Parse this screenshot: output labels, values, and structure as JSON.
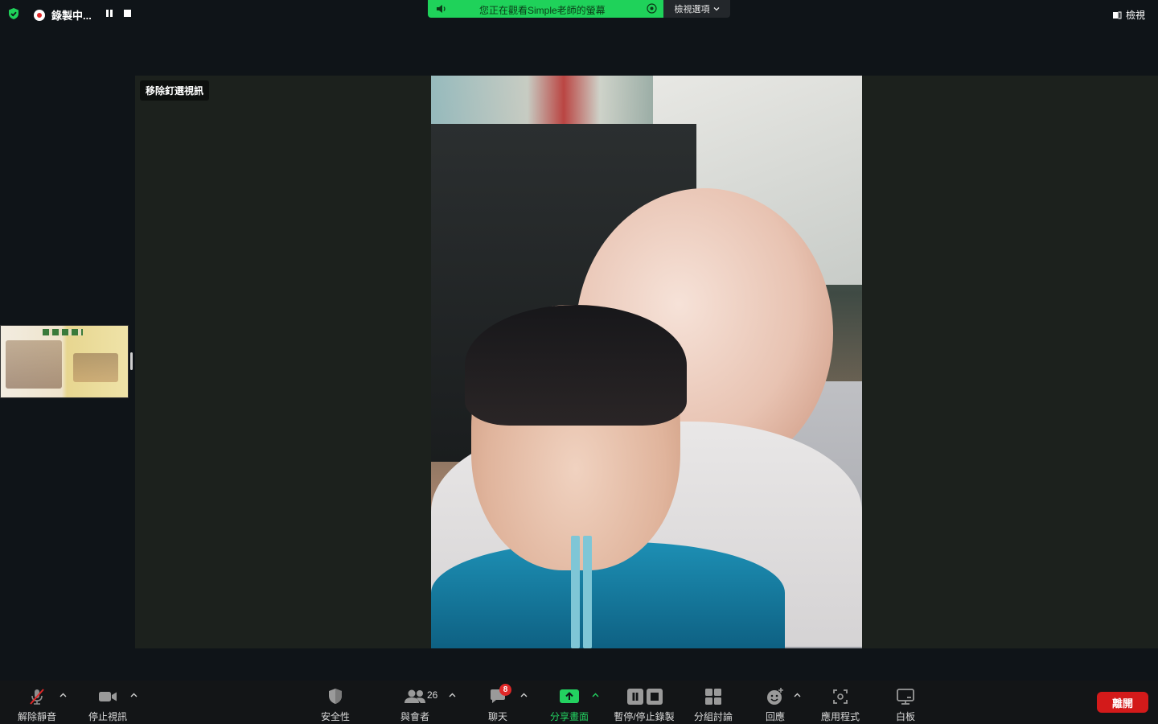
{
  "topbar": {
    "recording_label": "錄製中...",
    "banner_text": "您正在觀看Simple老師的螢幕",
    "view_options": "檢視選項",
    "view_button": "檢視"
  },
  "stage": {
    "unpin_label": "移除釘選視訊"
  },
  "toolbar": {
    "unmute": "解除靜音",
    "stop_video": "停止視訊",
    "security": "安全性",
    "participants": "與會者",
    "participants_count": "26",
    "chat": "聊天",
    "chat_badge": "8",
    "share_screen": "分享畫面",
    "pause_record": "暫停/停止錄製",
    "breakout": "分組討論",
    "reactions": "回應",
    "apps": "應用程式",
    "whiteboard": "白板",
    "leave": "離開"
  },
  "colors": {
    "accent_green": "#1fd25a",
    "leave_red": "#d31a1a",
    "toolbar_bg": "#131517",
    "stage_bg": "#1c211d"
  },
  "icons": [
    "shield-icon",
    "record-icon",
    "pause-icon",
    "stop-icon",
    "speaker-icon",
    "target-icon",
    "chevron-down-icon",
    "view-icon",
    "mic-muted-icon",
    "video-icon",
    "security-shield-icon",
    "participants-icon",
    "chat-icon",
    "share-screen-icon",
    "pause-record-icon",
    "breakout-icon",
    "reactions-icon",
    "apps-icon",
    "whiteboard-icon"
  ]
}
